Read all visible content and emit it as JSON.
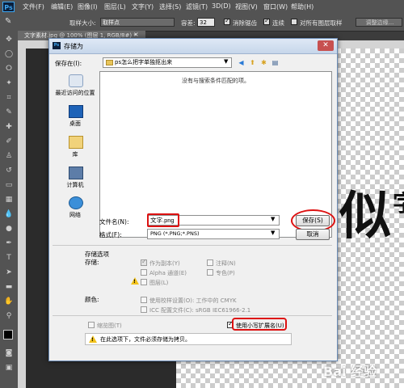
{
  "app": {
    "logo": "Ps"
  },
  "menubar": {
    "items": [
      "文件(F)",
      "编辑(E)",
      "图像(I)",
      "图层(L)",
      "文字(Y)",
      "选择(S)",
      "滤镜(T)",
      "3D(D)",
      "视图(V)",
      "窗口(W)",
      "帮助(H)"
    ]
  },
  "options": {
    "sample_size_label": "取样大小:",
    "sample_size_value": "取样点",
    "tolerance_label": "容差:",
    "tolerance_value": "32",
    "antialias_label": "消除锯齿",
    "antialias_checked": true,
    "contiguous_label": "连续",
    "contiguous_checked": true,
    "all_layers_label": "对所有图层取样",
    "all_layers_checked": false,
    "refine_edge_label": "调整边缘..."
  },
  "document": {
    "tab_label": "文字素材.jpg @ 100% (图层 1, RGB/8#) *",
    "close": "×"
  },
  "dialog": {
    "title": "存储为",
    "close_icon": "close-icon",
    "save_in_label": "保存在(I):",
    "save_in_value": "ps怎么把字单独抠出来",
    "empty_message": "没有与搜索条件匹配的项。",
    "places": [
      {
        "label": "最近访问的位置",
        "icon": "recent-places-icon"
      },
      {
        "label": "桌面",
        "icon": "desktop-icon"
      },
      {
        "label": "库",
        "icon": "library-icon"
      },
      {
        "label": "计算机",
        "icon": "computer-icon"
      },
      {
        "label": "网络",
        "icon": "network-icon"
      }
    ],
    "filename_label": "文件名(N):",
    "filename_value": "文字.png",
    "format_label": "格式(F):",
    "format_value": "PNG (*.PNG;*.PNS)",
    "save_button": "保存(S)",
    "cancel_button": "取消",
    "save_options_title": "存储选项",
    "store_label": "存储:",
    "options": {
      "as_copy": "作为副本(Y)",
      "notes": "注释(N)",
      "alpha": "Alpha 通道(E)",
      "spot": "专色(P)",
      "layers": "图层(L)"
    },
    "color_label": "颜色:",
    "proof_setup": "使用校样设置(O): 工作中的 CMYK",
    "icc_profile": "ICC 配置文件(C): sRGB IEC61966-2.1",
    "thumbnail": "缩览图(T)",
    "lowercase_ext": "使用小写扩展名(U)",
    "notice": "在此选项下，文件必须存储为拷贝。"
  },
  "canvas": {
    "art_text": "似",
    "art_text2": "字",
    "watermark": "Bai 经验"
  },
  "colors": {
    "accent_red": "#d11111",
    "ps_blue": "#3ea6f0"
  }
}
